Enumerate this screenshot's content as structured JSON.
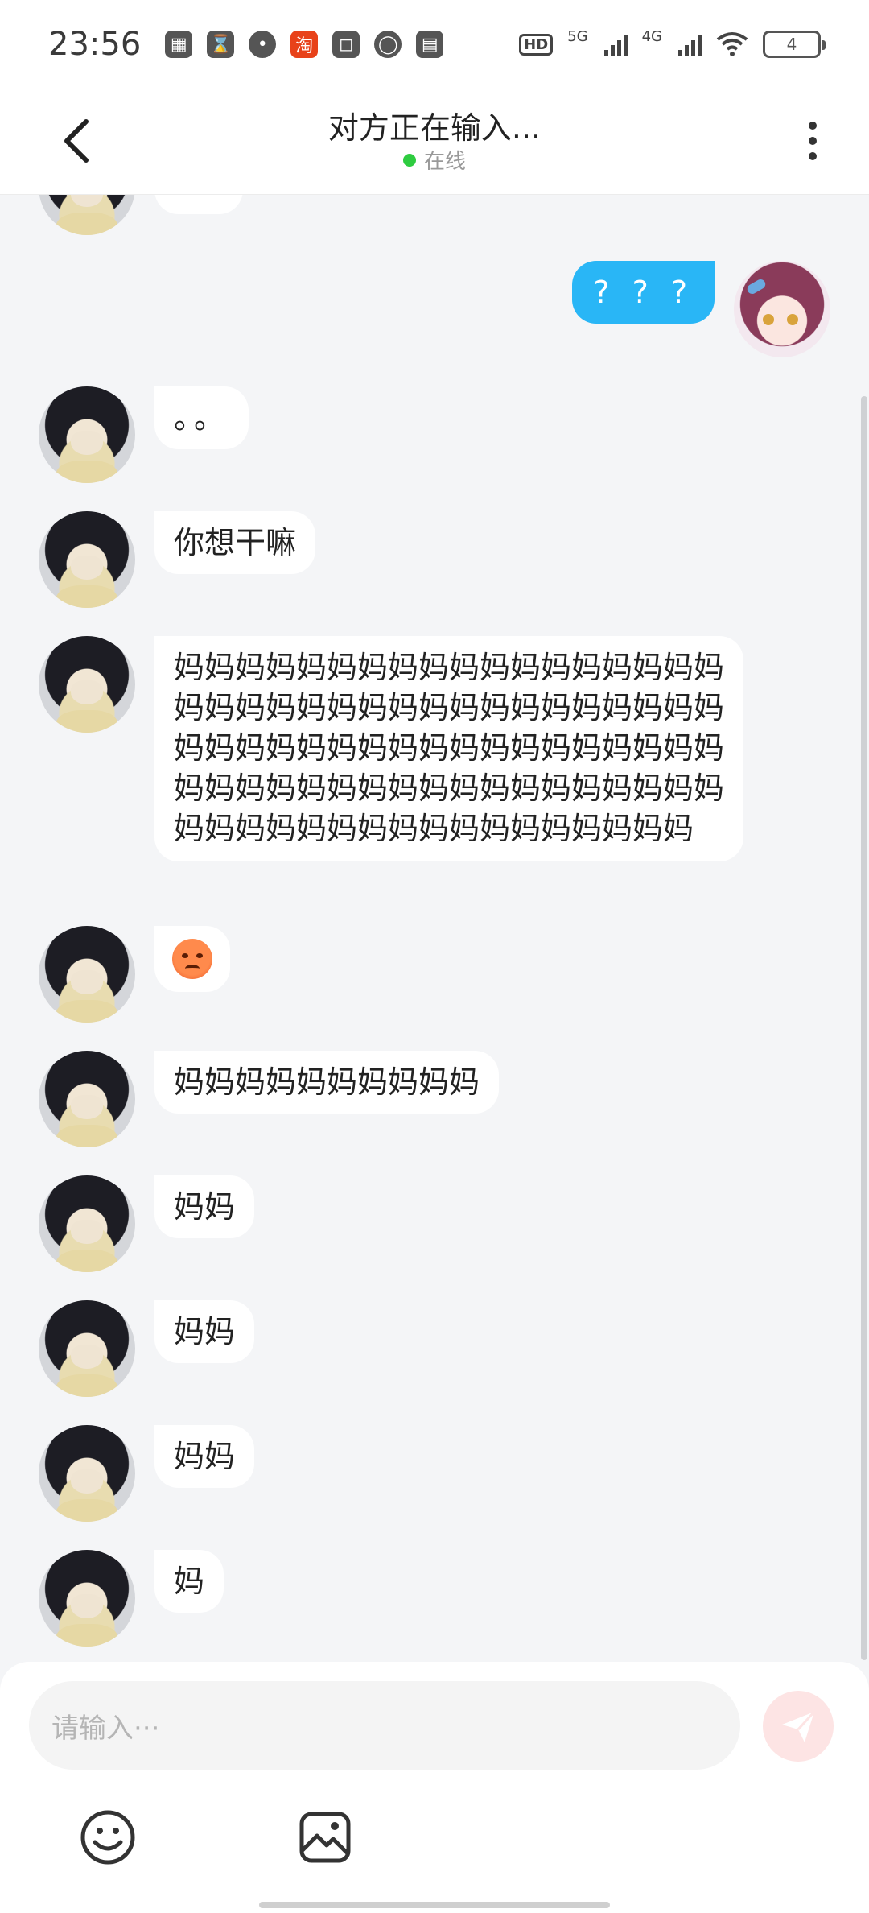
{
  "status_bar": {
    "time": "23:56",
    "apps": [
      "app-icon",
      "hourglass-icon",
      "chat-bubble-icon",
      "淘",
      "bag-icon",
      "cat-icon",
      "book-icon"
    ],
    "hd_label": "HD",
    "sim1_label": "5G",
    "sim2_label": "4G",
    "battery_level": "4"
  },
  "header": {
    "title": "对方正在输入...",
    "status": "在线",
    "status_color": "#2ecc40"
  },
  "messages": [
    {
      "side": "right",
      "text": "? ? ?"
    },
    {
      "side": "left",
      "text": "。。"
    },
    {
      "side": "left",
      "text": "你想干嘛"
    },
    {
      "side": "left",
      "text": "妈妈妈妈妈妈妈妈妈妈妈妈妈妈妈妈妈妈妈妈妈妈妈妈妈妈妈妈妈妈妈妈妈妈妈妈妈妈妈妈妈妈妈妈妈妈妈妈妈妈妈妈妈妈妈妈妈妈妈妈妈妈妈妈妈妈妈妈妈妈妈妈妈妈妈妈妈妈妈妈妈妈妈妈妈妈妈妈妈"
    },
    {
      "side": "left",
      "text": "angry-face-emoji"
    },
    {
      "side": "left",
      "text": "妈妈妈妈妈妈妈妈妈妈"
    },
    {
      "side": "left",
      "text": "妈妈"
    },
    {
      "side": "left",
      "text": "妈妈"
    },
    {
      "side": "left",
      "text": "妈妈"
    },
    {
      "side": "left",
      "text": "妈"
    }
  ],
  "input": {
    "placeholder": "请输入···"
  },
  "colors": {
    "my_bubble": "#29b6f6",
    "their_bubble": "#ffffff",
    "send_button": "#fde4e4"
  }
}
